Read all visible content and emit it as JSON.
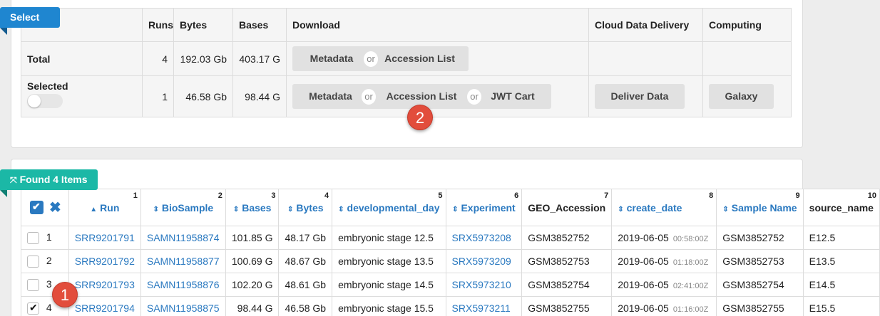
{
  "select_label": "Select",
  "found_label": "Found 4 Items",
  "summary": {
    "headers": [
      "",
      "Runs",
      "Bytes",
      "Bases",
      "Download",
      "Cloud Data Delivery",
      "Computing"
    ],
    "total": {
      "label": "Total",
      "runs": "4",
      "bytes": "192.03 Gb",
      "bases": "403.17 G",
      "metadata": "Metadata",
      "or": "or",
      "accession": "Accession List"
    },
    "selected": {
      "label": "Selected",
      "runs": "1",
      "bytes": "46.58 Gb",
      "bases": "98.44 G",
      "metadata": "Metadata",
      "or1": "or",
      "accession": "Accession List",
      "or2": "or",
      "jwt": "JWT Cart",
      "deliver": "Deliver Data",
      "galaxy": "Galaxy"
    }
  },
  "markers": {
    "one": "1",
    "two": "2"
  },
  "columns": [
    {
      "label": "Run",
      "idx": "1",
      "arrow": "▲"
    },
    {
      "label": "BioSample",
      "idx": "2",
      "arrow": "⇕"
    },
    {
      "label": "Bases",
      "idx": "3",
      "arrow": "⇕"
    },
    {
      "label": "Bytes",
      "idx": "4",
      "arrow": "⇕"
    },
    {
      "label": "developmental_day",
      "idx": "5",
      "arrow": "⇕"
    },
    {
      "label": "Experiment",
      "idx": "6",
      "arrow": "⇕"
    },
    {
      "label": "GEO_Accession",
      "idx": "7"
    },
    {
      "label": "create_date",
      "idx": "8",
      "arrow": "⇕"
    },
    {
      "label": "Sample Name",
      "idx": "9",
      "arrow": "⇕"
    },
    {
      "label": "source_name",
      "idx": "10"
    }
  ],
  "rows": [
    {
      "n": "1",
      "checked": false,
      "run": "SRR9201791",
      "biosample": "SAMN11958874",
      "bases": "101.85 G",
      "bytes": "48.17 Gb",
      "day": "embryonic stage 12.5",
      "experiment": "SRX5973208",
      "geo": "GSM3852752",
      "date": "2019-06-05",
      "time": "00:58:00Z",
      "sample": "GSM3852752",
      "source": "E12.5"
    },
    {
      "n": "2",
      "checked": false,
      "run": "SRR9201792",
      "biosample": "SAMN11958877",
      "bases": "100.69 G",
      "bytes": "48.67 Gb",
      "day": "embryonic stage 13.5",
      "experiment": "SRX5973209",
      "geo": "GSM3852753",
      "date": "2019-06-05",
      "time": "01:18:00Z",
      "sample": "GSM3852753",
      "source": "E13.5"
    },
    {
      "n": "3",
      "checked": false,
      "run": "SRR9201793",
      "biosample": "SAMN11958876",
      "bases": "102.20 G",
      "bytes": "48.61 Gb",
      "day": "embryonic stage 14.5",
      "experiment": "SRX5973210",
      "geo": "GSM3852754",
      "date": "2019-06-05",
      "time": "02:41:00Z",
      "sample": "GSM3852754",
      "source": "E14.5"
    },
    {
      "n": "4",
      "checked": true,
      "run": "SRR9201794",
      "biosample": "SAMN11958875",
      "bases": "98.44 G",
      "bytes": "46.58 Gb",
      "day": "embryonic stage 15.5",
      "experiment": "SRX5973211",
      "geo": "GSM3852755",
      "date": "2019-06-05",
      "time": "01:16:00Z",
      "sample": "GSM3852755",
      "source": "E15.5"
    }
  ]
}
